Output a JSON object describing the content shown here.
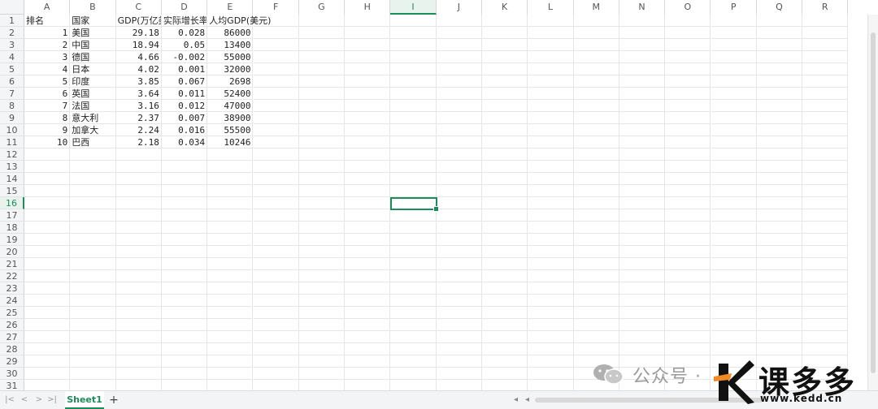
{
  "columns": [
    "A",
    "B",
    "C",
    "D",
    "E",
    "F",
    "G",
    "H",
    "I",
    "J",
    "K",
    "L",
    "M",
    "N",
    "O",
    "P",
    "Q",
    "R"
  ],
  "active_column": "I",
  "active_row": 16,
  "row_count": 31,
  "header_row": [
    "排名",
    "国家",
    "GDP(万亿美元)",
    "实际增长率",
    "人均GDP(美元)"
  ],
  "rows": [
    [
      "1",
      "美国",
      "29.18",
      "0.028",
      "86000"
    ],
    [
      "2",
      "中国",
      "18.94",
      "0.05",
      "13400"
    ],
    [
      "3",
      "德国",
      "4.66",
      "-0.002",
      "55000"
    ],
    [
      "4",
      "日本",
      "4.02",
      "0.001",
      "32000"
    ],
    [
      "5",
      "印度",
      "3.85",
      "0.067",
      "2698"
    ],
    [
      "6",
      "英国",
      "3.64",
      "0.011",
      "52400"
    ],
    [
      "7",
      "法国",
      "3.16",
      "0.012",
      "47000"
    ],
    [
      "8",
      "意大利",
      "2.37",
      "0.007",
      "38900"
    ],
    [
      "9",
      "加拿大",
      "2.24",
      "0.016",
      "55500"
    ],
    [
      "10",
      "巴西",
      "2.18",
      "0.034",
      "10246"
    ]
  ],
  "tabs": {
    "sheet_name": "Sheet1",
    "add_label": "+"
  },
  "nav": {
    "first": "|<",
    "prev": "<",
    "next": ">",
    "last": ">|"
  },
  "watermark": {
    "channel": "公众号",
    "separator": "·",
    "brand": "课多多",
    "domain": "www.kedd.cn"
  },
  "colors": {
    "accent": "#1e8c5a"
  }
}
